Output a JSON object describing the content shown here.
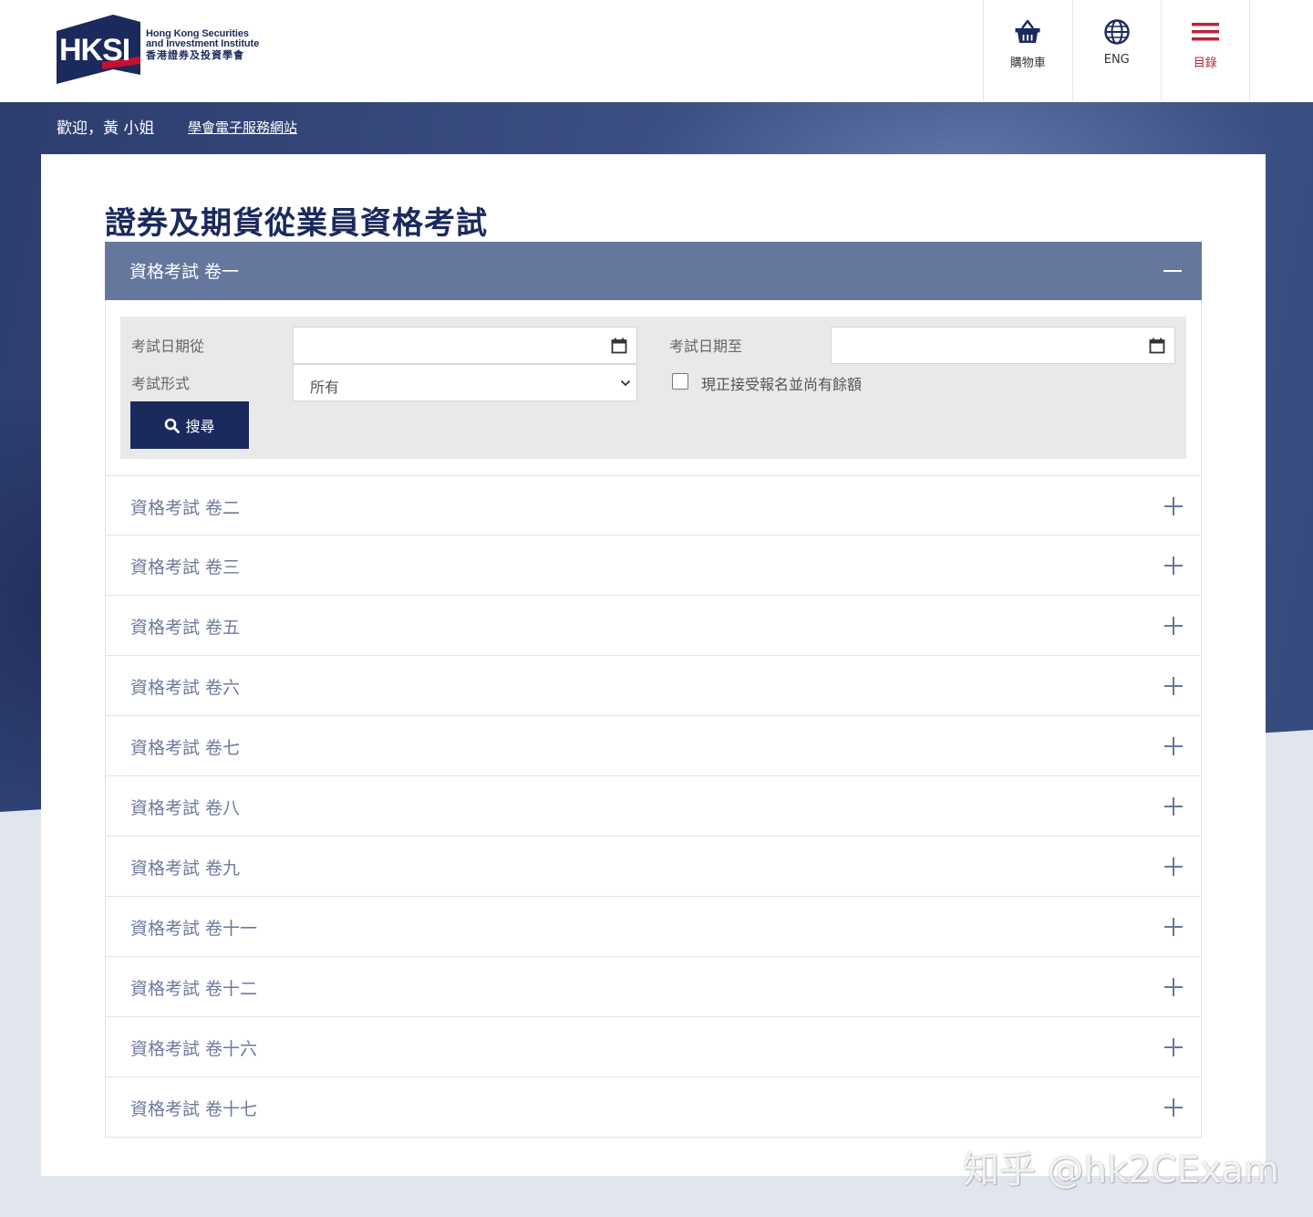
{
  "logo": {
    "mark_text": "HKSI",
    "name_en_1": "Hong Kong Securities",
    "name_en_2": "and Investment Institute",
    "name_zh": "香港證券及投資學會"
  },
  "nav": [
    {
      "label": "購物車",
      "icon": "basket-icon"
    },
    {
      "label": "ENG",
      "icon": "globe-icon"
    },
    {
      "label": "目錄",
      "icon": "menu-icon"
    }
  ],
  "colors": {
    "primary": "#1b2a5c",
    "accordion_active": "#66779e",
    "accent_red": "#b8263d"
  },
  "welcome": "歡迎，黃 小姐",
  "portal_link": "學會電子服務網站",
  "page_title": "證券及期貨從業員資格考試",
  "open_section": {
    "title": "資格考試 卷一",
    "filters": {
      "date_from_label": "考試日期從",
      "date_from_value": "",
      "date_to_label": "考試日期至",
      "date_to_value": "",
      "format_label": "考試形式",
      "format_value": "所有",
      "checkbox_label": "現正接受報名並尚有餘額",
      "checkbox_checked": false,
      "search_label": "搜尋"
    }
  },
  "sections": [
    "資格考試 卷二",
    "資格考試 卷三",
    "資格考試 卷五",
    "資格考試 卷六",
    "資格考試 卷七",
    "資格考試 卷八",
    "資格考試 卷九",
    "資格考試 卷十一",
    "資格考試 卷十二",
    "資格考試 卷十六",
    "資格考試 卷十七"
  ],
  "watermark": "知乎 @hk2CExam"
}
